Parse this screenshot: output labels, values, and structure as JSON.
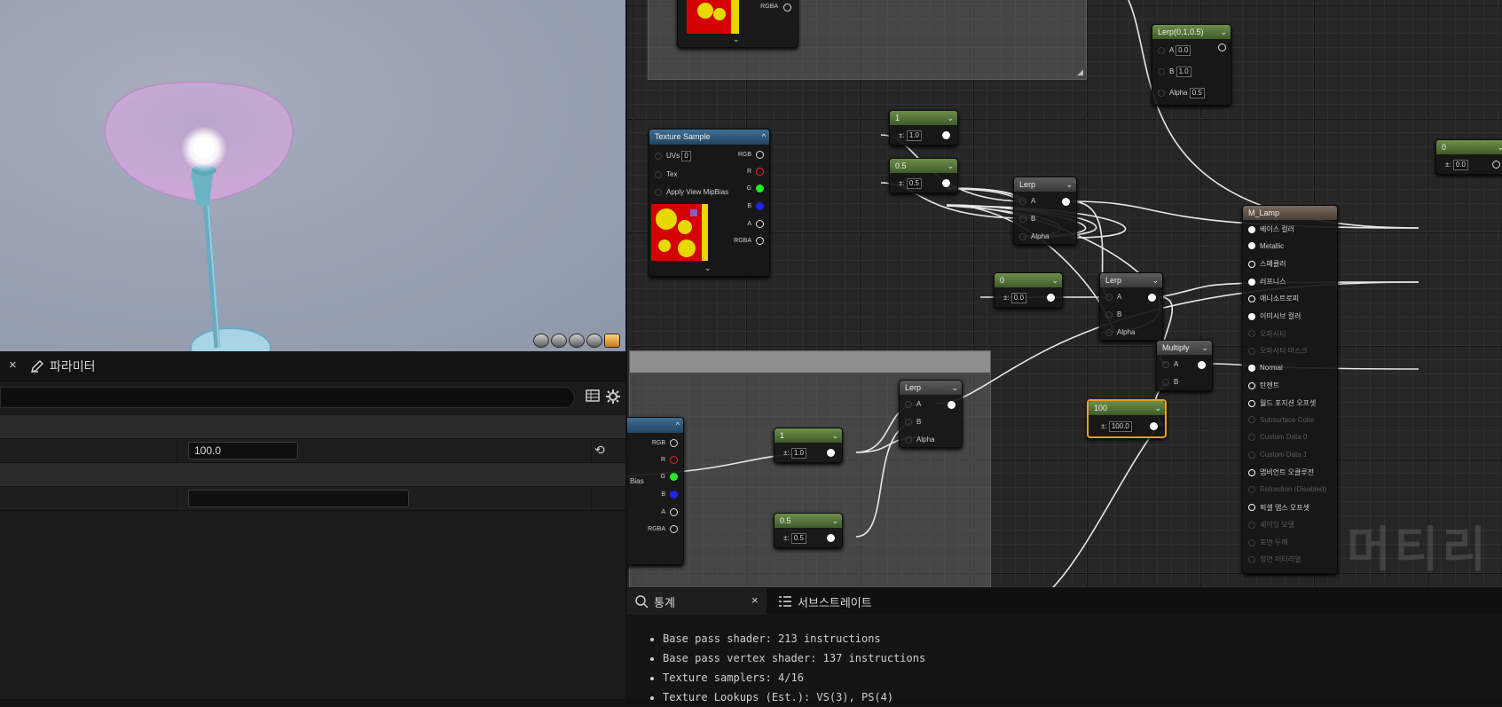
{
  "viewport": {
    "preview_icons": [
      "cylinder-preview-icon",
      "sphere-preview-icon",
      "plane-preview-icon",
      "cube-preview-icon",
      "custom-mesh-preview-icon"
    ]
  },
  "details": {
    "tab_label": "파라미터",
    "close_symbol": "×",
    "search_placeholder": "",
    "rows": [
      {
        "value": "100.0"
      },
      {
        "value": ""
      }
    ]
  },
  "graph": {
    "nodes": {
      "lerp_const": {
        "title": "Lerp(0,1,0.5)",
        "a": "0.0",
        "b": "1.0",
        "alpha": "0.5",
        "a_label": "A",
        "b_label": "B",
        "alpha_label": "Alpha"
      },
      "const_right": {
        "title": "0",
        "value": "0.0"
      },
      "texture_sample": {
        "title": "Texture Sample",
        "uvs_label": "UVs",
        "uvs": "0",
        "tex_label": "Tex",
        "mip_label": "Apply View MipBias",
        "outs": [
          "RGB",
          "R",
          "G",
          "B",
          "A",
          "RGBA"
        ]
      },
      "top_rgba_label": "RGBA",
      "c1": {
        "title": "1",
        "value": "1.0"
      },
      "c05": {
        "title": "0.5",
        "value": "0.5"
      },
      "lerp1": {
        "title": "Lerp",
        "a": "A",
        "b": "B",
        "alpha": "Alpha"
      },
      "c0": {
        "title": "0",
        "value": "0.0"
      },
      "lerp2": {
        "title": "Lerp",
        "a": "A",
        "b": "B",
        "alpha": "Alpha"
      },
      "multiply": {
        "title": "Multiply",
        "a": "A",
        "b": "B"
      },
      "c100": {
        "title": "100",
        "value": "100.0"
      },
      "lerp3": {
        "title": "Lerp",
        "a": "A",
        "b": "B",
        "alpha": "Alpha"
      },
      "c1b": {
        "title": "1",
        "value": "1.0"
      },
      "c05b": {
        "title": "0.5",
        "value": "0.5"
      },
      "tex2": {
        "outs": [
          "RGB",
          "R",
          "G",
          "B",
          "A",
          "RGBA"
        ],
        "bias_label": "Bias"
      },
      "material": {
        "title": "M_Lamp",
        "pins": [
          {
            "label": "베이스 컬러",
            "state": "on"
          },
          {
            "label": "Metallic",
            "state": "on"
          },
          {
            "label": "스페큘러",
            "state": "hollow"
          },
          {
            "label": "러프니스",
            "state": "on"
          },
          {
            "label": "애니소트로피",
            "state": "hollow"
          },
          {
            "label": "이미시브 컬러",
            "state": "on"
          },
          {
            "label": "오파시티",
            "state": "dim"
          },
          {
            "label": "오파시티 마스크",
            "state": "dim"
          },
          {
            "label": "Normal",
            "state": "on"
          },
          {
            "label": "탄젠트",
            "state": "hollow"
          },
          {
            "label": "월드 포지션 오프셋",
            "state": "hollow"
          },
          {
            "label": "Subsurface Color",
            "state": "dim"
          },
          {
            "label": "Custom Data 0",
            "state": "dim"
          },
          {
            "label": "Custom Data 1",
            "state": "dim"
          },
          {
            "label": "앰비언트 오클루전",
            "state": "hollow"
          },
          {
            "label": "Refraction (Disabled)",
            "state": "dim"
          },
          {
            "label": "픽셀 뎁스 오프셋",
            "state": "hollow"
          },
          {
            "label": "셰이딩 모델",
            "state": "dim"
          },
          {
            "label": "표면 두께",
            "state": "dim"
          },
          {
            "label": "정면 머티리얼",
            "state": "dim"
          }
        ]
      }
    },
    "watermark": "머티리"
  },
  "stats": {
    "tab_stats": "통계",
    "tab_substrate": "서브스트레이트",
    "close_symbol": "×",
    "lines": [
      "Base pass shader: 213 instructions",
      "Base pass vertex shader: 137 instructions",
      "Texture samplers: 4/16",
      "Texture Lookups (Est.): VS(3), PS(4)"
    ]
  },
  "colors": {
    "accent_orange": "#e6a020",
    "node_green": "#5b7d3c",
    "node_blue": "#2f5a7d"
  }
}
